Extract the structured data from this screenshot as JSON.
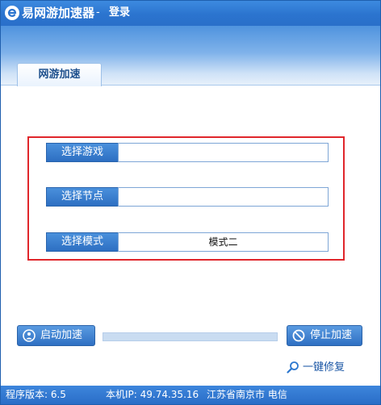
{
  "titlebar": {
    "app_title": "易网游加速器",
    "separator": "-",
    "login_label": "登录"
  },
  "tabs": [
    {
      "label": "网游加速",
      "active": true
    }
  ],
  "form": {
    "rows": [
      {
        "label": "选择游戏",
        "value": ""
      },
      {
        "label": "选择节点",
        "value": ""
      },
      {
        "label": "选择模式",
        "value": "模式二"
      }
    ]
  },
  "controls": {
    "start_label": "启动加速",
    "stop_label": "停止加速",
    "repair_label": "一键修复",
    "progress": 0
  },
  "statusbar": {
    "version": "程序版本: 6.5",
    "ip": "本机IP: 49.74.35.16",
    "location": "江苏省南京市 电信"
  },
  "icons": {
    "logo": "app-logo-icon",
    "start": "person-icon",
    "stop": "no-entry-icon",
    "repair": "magnifier-icon"
  },
  "colors": {
    "accent": "#2b74cf",
    "highlight_frame": "#e0262b"
  }
}
